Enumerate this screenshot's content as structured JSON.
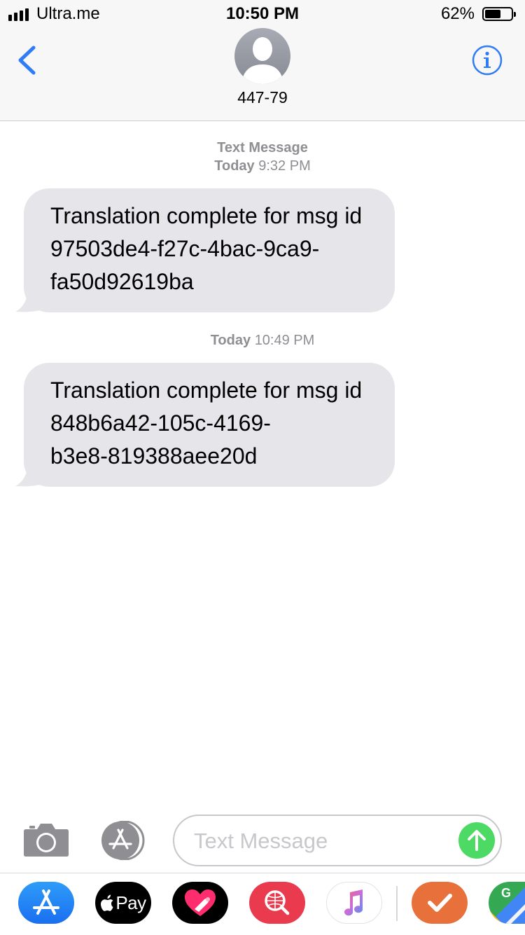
{
  "status_bar": {
    "carrier": "Ultra.me",
    "time": "10:50 PM",
    "battery_percent_text": "62%",
    "battery_level": 0.62
  },
  "header": {
    "contact_name": "447-79",
    "back_icon": "chevron-left-icon",
    "info_icon": "info-icon"
  },
  "conversation": {
    "service_label": "Text Message",
    "messages": [
      {
        "day": "Today",
        "time": "9:32 PM",
        "lines": [
          "Translation complete for msg id",
          "97503de4-f27c-4bac-9ca9-",
          "fa50d92619ba"
        ]
      },
      {
        "day": "Today",
        "time": "10:49 PM",
        "lines": [
          "Translation complete for msg id",
          "848b6a42-105c-4169-",
          "b3e8-819388aee20d"
        ]
      }
    ]
  },
  "composer": {
    "placeholder": "Text Message",
    "camera_icon": "camera-icon",
    "appstore_icon": "app-store-icon",
    "send_icon": "send-arrow-up-icon"
  },
  "app_drawer": {
    "apps": [
      {
        "name": "App Store",
        "icon": "app-store-icon"
      },
      {
        "name": "Apple Pay",
        "icon": "apple-pay-icon",
        "label": "Pay"
      },
      {
        "name": "Digital Touch",
        "icon": "digital-touch-icon"
      },
      {
        "name": "Images Search",
        "icon": "images-search-icon"
      },
      {
        "name": "Music",
        "icon": "music-icon"
      },
      {
        "name": "Check",
        "icon": "checkmark-icon"
      },
      {
        "name": "Google Maps",
        "icon": "google-maps-icon",
        "label": "G"
      }
    ]
  },
  "colors": {
    "accent_blue": "#2f7cf6",
    "bubble_gray": "#e5e5ea",
    "meta_gray": "#8e8e93",
    "send_green": "#4cd964"
  }
}
